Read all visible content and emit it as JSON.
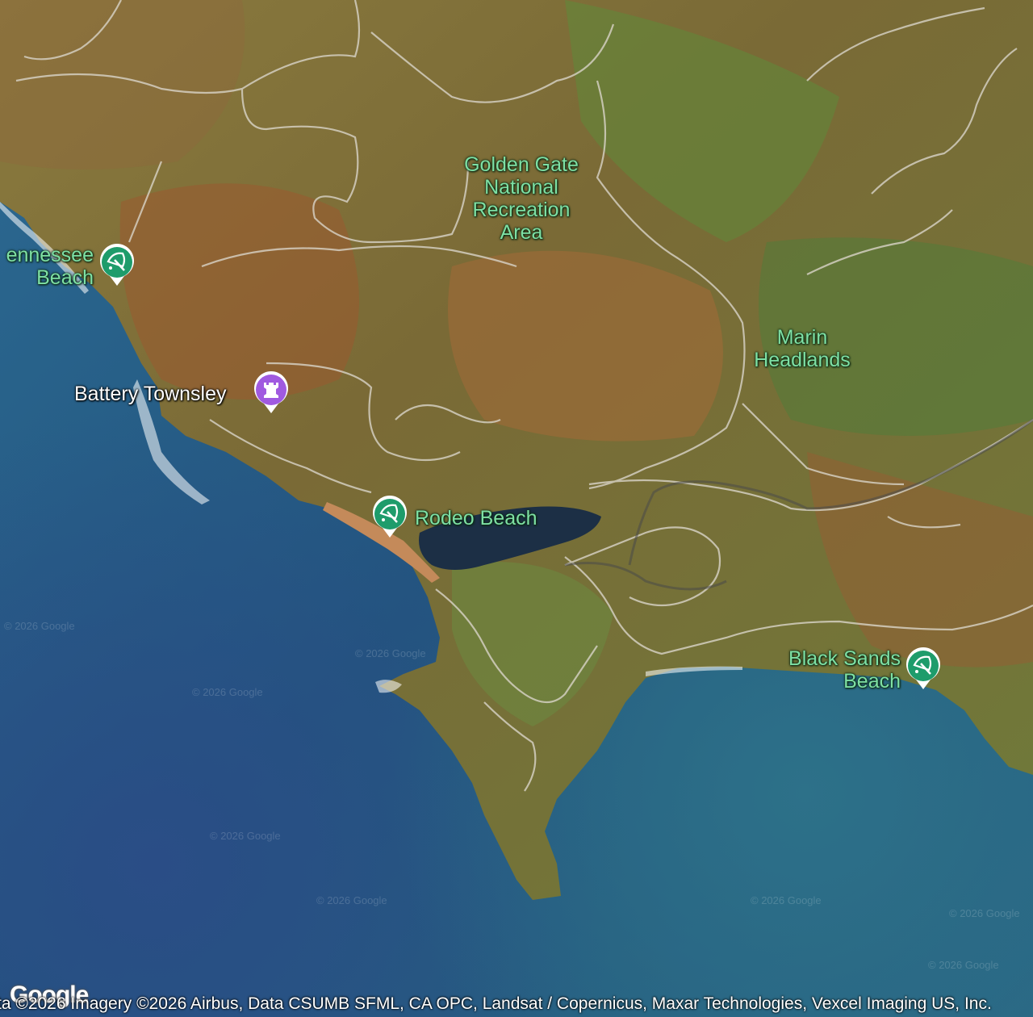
{
  "map": {
    "view": "satellite",
    "colors": {
      "ocean_deep": "#1f4f7a",
      "ocean_near": "#2f6e8e",
      "land_green": "#6e8a3c",
      "land_brown": "#a2643a",
      "road": "#d9d4c8",
      "lagoon": "#1c2f45",
      "place_label": "#7ee0a4",
      "beach_pin": "#1e9c6b",
      "landmark_pin": "#a05ae0"
    }
  },
  "labels": {
    "ggnra": [
      "Golden Gate",
      "National",
      "Recreation",
      "Area"
    ],
    "marin": [
      "Marin",
      "Headlands"
    ]
  },
  "places": {
    "tennessee": [
      "ennessee",
      "Beach"
    ],
    "battery": "Battery Townsley",
    "rodeo": "Rodeo Beach",
    "black_sands": [
      "Black Sands",
      "Beach"
    ]
  },
  "icons": {
    "beach": "umbrella-icon",
    "landmark": "castle-tower-icon"
  },
  "watermark": "© 2026 Google",
  "attribution": "ta ©2026 Imagery ©2026 Airbus, Data CSUMB SFML, CA OPC, Landsat / Copernicus, Maxar Technologies, Vexcel Imaging US, Inc.",
  "logo": "Google"
}
